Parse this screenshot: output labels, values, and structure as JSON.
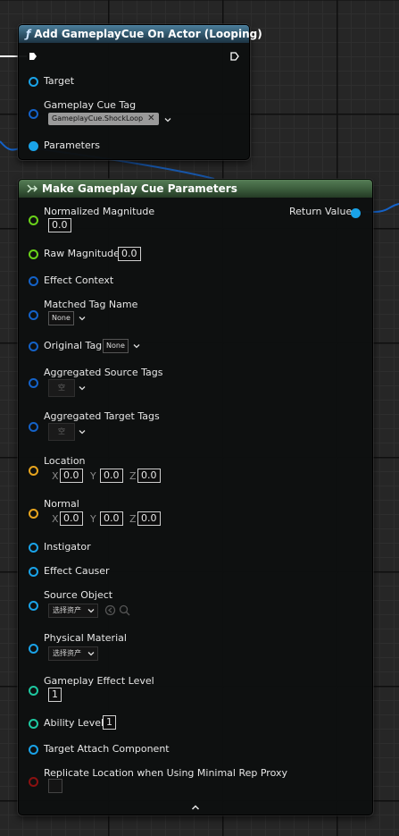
{
  "node_add_cue": {
    "title": "Add GameplayCue On Actor (Looping)",
    "title_icon": "ƒ",
    "pins": {
      "target": "Target",
      "gameplay_cue_tag": "Gameplay Cue Tag",
      "tag_value": "GameplayCue.ShockLoop",
      "tag_clear": "✕",
      "parameters": "Parameters"
    }
  },
  "node_make_params": {
    "title": "Make Gameplay Cue Parameters",
    "return_value": "Return Value",
    "pins": {
      "normalized_magnitude": "Normalized Magnitude",
      "normalized_magnitude_value": "0.0",
      "raw_magnitude": "Raw Magnitude",
      "raw_magnitude_value": "0.0",
      "effect_context": "Effect Context",
      "matched_tag_name": "Matched Tag Name",
      "matched_tag_value": "None",
      "original_tag": "Original Tag",
      "original_tag_value": "None",
      "aggregated_source_tags": "Aggregated Source Tags",
      "aggregated_source_value": "空",
      "aggregated_target_tags": "Aggregated Target Tags",
      "aggregated_target_value": "空",
      "location": "Location",
      "location_x": "0.0",
      "location_y": "0.0",
      "location_z": "0.0",
      "normal": "Normal",
      "normal_x": "0.0",
      "normal_y": "0.0",
      "normal_z": "0.0",
      "axis_x": "X",
      "axis_y": "Y",
      "axis_z": "Z",
      "instigator": "Instigator",
      "effect_causer": "Effect Causer",
      "source_object": "Source Object",
      "source_object_value": "选择资产",
      "physical_material": "Physical Material",
      "physical_material_value": "选择资产",
      "gameplay_effect_level": "Gameplay Effect Level",
      "gameplay_effect_level_value": "1",
      "ability_level": "Ability Level",
      "ability_level_value": "1",
      "target_attach_component": "Target Attach Component",
      "replicate_location": "Replicate Location when Using Minimal Rep Proxy"
    }
  },
  "colors": {
    "object_pin": "#1aa3e8",
    "float_pin": "#6ad21a",
    "struct_pin": "#1462c8",
    "vector_pin": "#e8a51e",
    "int_pin": "#1ec8a0",
    "bool_pin": "#8a1111"
  },
  "icons": {
    "exec_in": "exec-pin-icon",
    "exec_out": "exec-out-icon",
    "make_struct": "make-struct-icon",
    "chevron": "chevron-down-icon",
    "use_selected": "use-selected-icon",
    "browse": "search-icon",
    "collapse": "chevron-up-icon"
  }
}
